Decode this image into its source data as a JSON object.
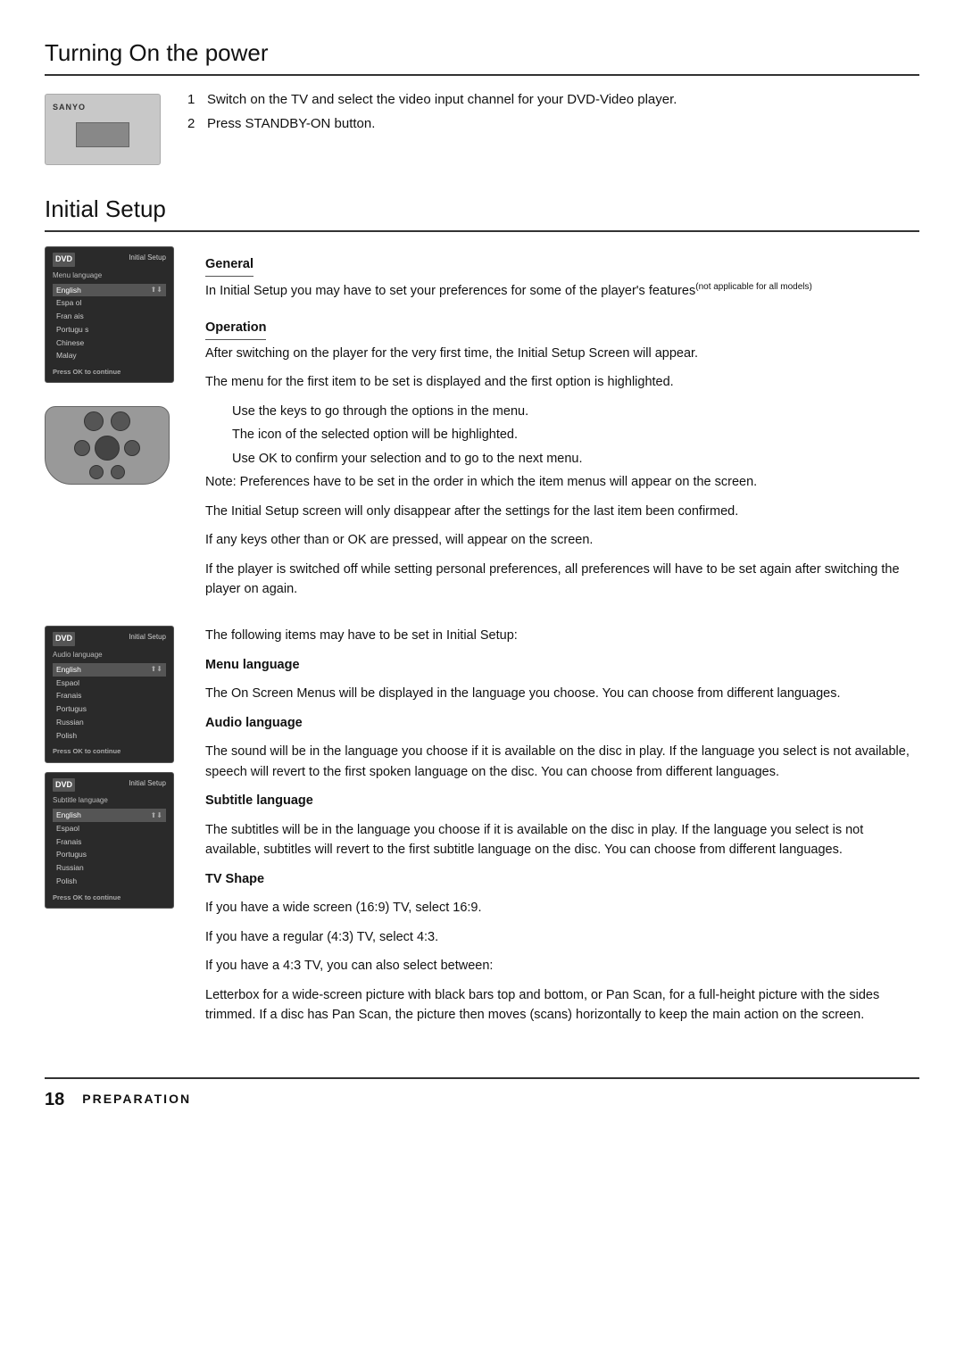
{
  "turning_on": {
    "heading": "Turning On the power",
    "steps": [
      "Switch on the TV and select the video input channel for your DVD-Video player.",
      "Press STANDBY-ON button."
    ]
  },
  "initial_setup": {
    "heading": "Initial Setup",
    "general": {
      "sub_heading": "General",
      "text": "In Initial Setup  you may have to set your preferences for some of the player's features",
      "text_note": "(not applicable for all models)"
    },
    "operation": {
      "sub_heading": "Operation",
      "paragraphs": [
        "After switching on the player for the very first time, the  Initial Setup Screen will appear.",
        "The menu for the first item to be set is displayed and the first option is highlighted.",
        "Use the      keys to go through the options in the menu.",
        "The icon of the selected option will be highlighted.",
        "Use OK to confirm your selection and to go to the next menu.",
        "Note: Preferences have to be set in the order in which the item menus will appear on the screen.",
        "The  Initial Setup  screen will only disappear after the settings for the last item been confirmed.",
        "If any keys other than    or OK are pressed,  will appear on the screen.",
        "If the player is switched off while setting personal preferences, all preferences will have to be set again after switching the player on again.",
        "The following items may have to be set in Initial Setup:",
        "Menu language",
        "The On Screen Menus will be displayed in the language you choose. You can choose from different languages.",
        "Audio language",
        "The sound will be in the language you choose if it is available on the disc in play. If the language you select is not available, speech will revert to the first spoken language on the disc. You can choose from different languages.",
        "Subtitle language",
        "The subtitles will be in the language you choose if it is available on the disc in play. If the language you select is not available, subtitles will revert to the first subtitle language on the disc. You can choose from different languages.",
        "TV Shape",
        "If you have a wide screen (16:9) TV, select 16:9.",
        "If you have a regular (4:3) TV, select 4:3.",
        "If you have a 4:3 TV, you can also select between:",
        "Letterbox for a  wide-screen  picture with black bars top and bottom, or Pan Scan, for a full-height picture with the sides trimmed. If a disc has Pan Scan, the picture then moves (scans) horizontally to keep the main action on the screen."
      ]
    },
    "dvd_menu_language": {
      "header_logo": "DVD",
      "header_title": "Initial Setup",
      "label": "Menu language",
      "items": [
        "English",
        "Espa ol",
        "Fran ais",
        "Portugu s",
        "Chinese",
        "Malay"
      ],
      "highlighted": "English",
      "footer": "Press OK to continue"
    },
    "dvd_audio_language": {
      "header_logo": "DVD",
      "header_title": "Initial Setup",
      "label": "Audio language",
      "items": [
        "English",
        "Espaol",
        "Franais",
        "Portugus",
        "Russian",
        "Polish"
      ],
      "highlighted": "English",
      "footer": "Press OK to continue"
    },
    "dvd_subtitle_language": {
      "header_logo": "DVD",
      "header_title": "Initial Setup",
      "label": "Subtitle language",
      "items": [
        "English",
        "Espaol",
        "Franais",
        "Portugus",
        "Russian",
        "Polish"
      ],
      "highlighted": "English",
      "footer": "Press OK to continue"
    }
  },
  "footer": {
    "page_number": "18",
    "section_label": "PREPARATION"
  }
}
